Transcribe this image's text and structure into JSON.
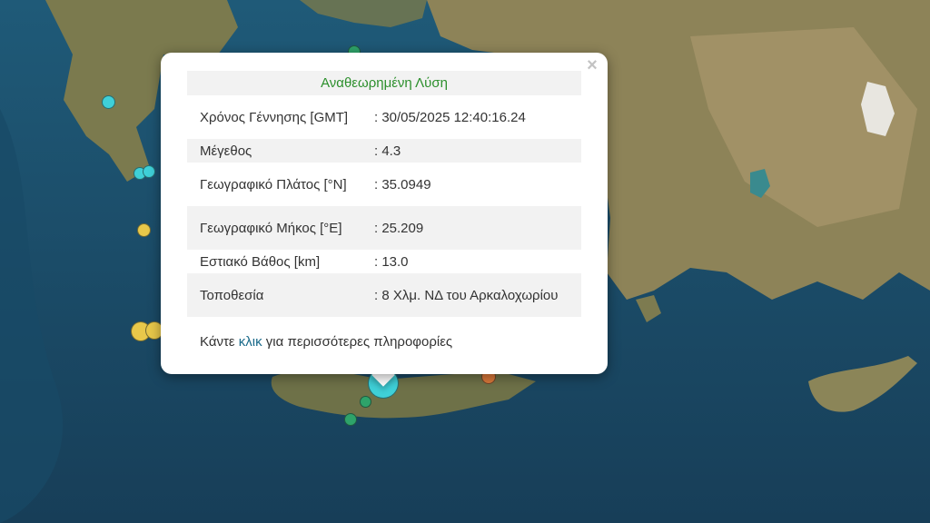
{
  "popup": {
    "title": "Αναθεωρημένη Λύση",
    "close_glyph": "×",
    "rows": [
      {
        "label": "Χρόνος Γέννησης [GMT]",
        "value": ": 30/05/2025 12:40:16.24"
      },
      {
        "label": "Μέγεθος",
        "value": ": 4.3"
      },
      {
        "label": "Γεωγραφικό Πλάτος [°N]",
        "value": ": 35.0949"
      },
      {
        "label": "Γεωγραφικό Μήκος [°E]",
        "value": ": 25.209"
      },
      {
        "label": "Εστιακό Βάθος [km]",
        "value": ": 13.0"
      },
      {
        "label": "Τοποθεσία",
        "value": ": 8 Χλμ. ΝΔ του Αρκαλοχωρίου"
      }
    ],
    "footer": {
      "before": "Κάντε ",
      "link": "κλικ",
      "after": " για περισσότερες πληροφορίες"
    }
  },
  "colors": {
    "sea": "#1e4f6e",
    "land": "#8d8358",
    "marker_cyan": "#3fd0d8",
    "marker_yellow": "#e8c84a",
    "marker_green": "#2ea36a",
    "marker_orange": "#d9783a",
    "title_green": "#2c8f2c"
  }
}
